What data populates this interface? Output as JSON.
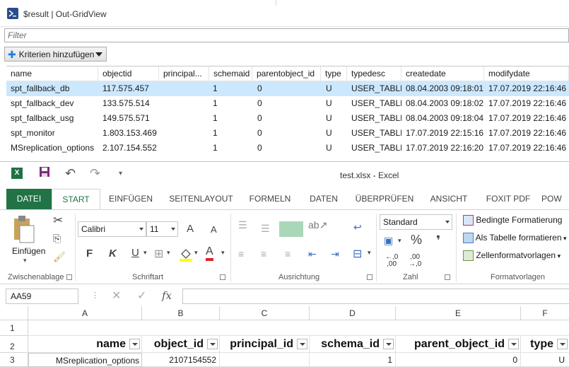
{
  "gridview": {
    "title": "$result | Out-GridView",
    "filter_placeholder": "Filter",
    "criteria_button": "Kriterien hinzufügen",
    "columns": [
      "name",
      "objectid",
      "principal...",
      "schemaid",
      "parentobject_id",
      "type",
      "typedesc",
      "createdate",
      "modifydate"
    ],
    "rows": [
      [
        "spt_fallback_db",
        "117.575.457",
        "",
        "1",
        "0",
        "U",
        "USER_TABLE",
        "08.04.2003 09:18:01",
        "17.07.2019 22:16:46"
      ],
      [
        "spt_fallback_dev",
        "133.575.514",
        "",
        "1",
        "0",
        "U",
        "USER_TABLE",
        "08.04.2003 09:18:02",
        "17.07.2019 22:16:46"
      ],
      [
        "spt_fallback_usg",
        "149.575.571",
        "",
        "1",
        "0",
        "U",
        "USER_TABLE",
        "08.04.2003 09:18:04",
        "17.07.2019 22:16:46"
      ],
      [
        "spt_monitor",
        "1.803.153.469",
        "",
        "1",
        "0",
        "U",
        "USER_TABLE",
        "17.07.2019 22:15:16",
        "17.07.2019 22:16:46"
      ],
      [
        "MSreplication_options",
        "2.107.154.552",
        "",
        "1",
        "0",
        "U",
        "USER_TABLE",
        "17.07.2019 22:16:20",
        "17.07.2019 22:16:46"
      ]
    ],
    "selected_row": 0
  },
  "excel": {
    "title": "test.xlsx - Excel",
    "tabs": [
      "DATEI",
      "START",
      "EINFÜGEN",
      "SEITENLAYOUT",
      "FORMELN",
      "DATEN",
      "ÜBERPRÜFEN",
      "ANSICHT",
      "FOXIT PDF",
      "POW"
    ],
    "active_tab": "START",
    "clipboard": {
      "paste_label": "Einfügen",
      "group": "Zwischenablage"
    },
    "font": {
      "name": "Calibri",
      "size": "11",
      "group": "Schriftart",
      "bold": "F",
      "italic": "K",
      "underline": "U",
      "grow": "A",
      "shrink": "A",
      "color": "A"
    },
    "alignment": {
      "group": "Ausrichtung"
    },
    "number": {
      "format": "Standard",
      "group": "Zahl",
      "percent": "%",
      "comma": "❜",
      "inc_decimal": "←,0\n,00",
      "dec_decimal": ",00\n→,0"
    },
    "styles": {
      "group": "Formatvorlagen",
      "conditional": "Bedingte Formatierung",
      "as_table": "Als Tabelle formatieren",
      "cell_styles": "Zellenformatvorlagen"
    },
    "name_box": "AA59",
    "fx": "fx",
    "columns": [
      "A",
      "B",
      "C",
      "D",
      "E",
      "F"
    ],
    "rows": [
      "1",
      "2",
      "3"
    ],
    "header_row": [
      "name",
      "object_id",
      "principal_id",
      "schema_id",
      "parent_object_id",
      "type"
    ],
    "data_row": [
      "MSreplication_options",
      "2107154552",
      "",
      "1",
      "0",
      "U"
    ]
  },
  "colors": {
    "excel_green": "#217346",
    "selection_blue": "#cce8ff",
    "ps_blue": "#2a4c8c"
  }
}
